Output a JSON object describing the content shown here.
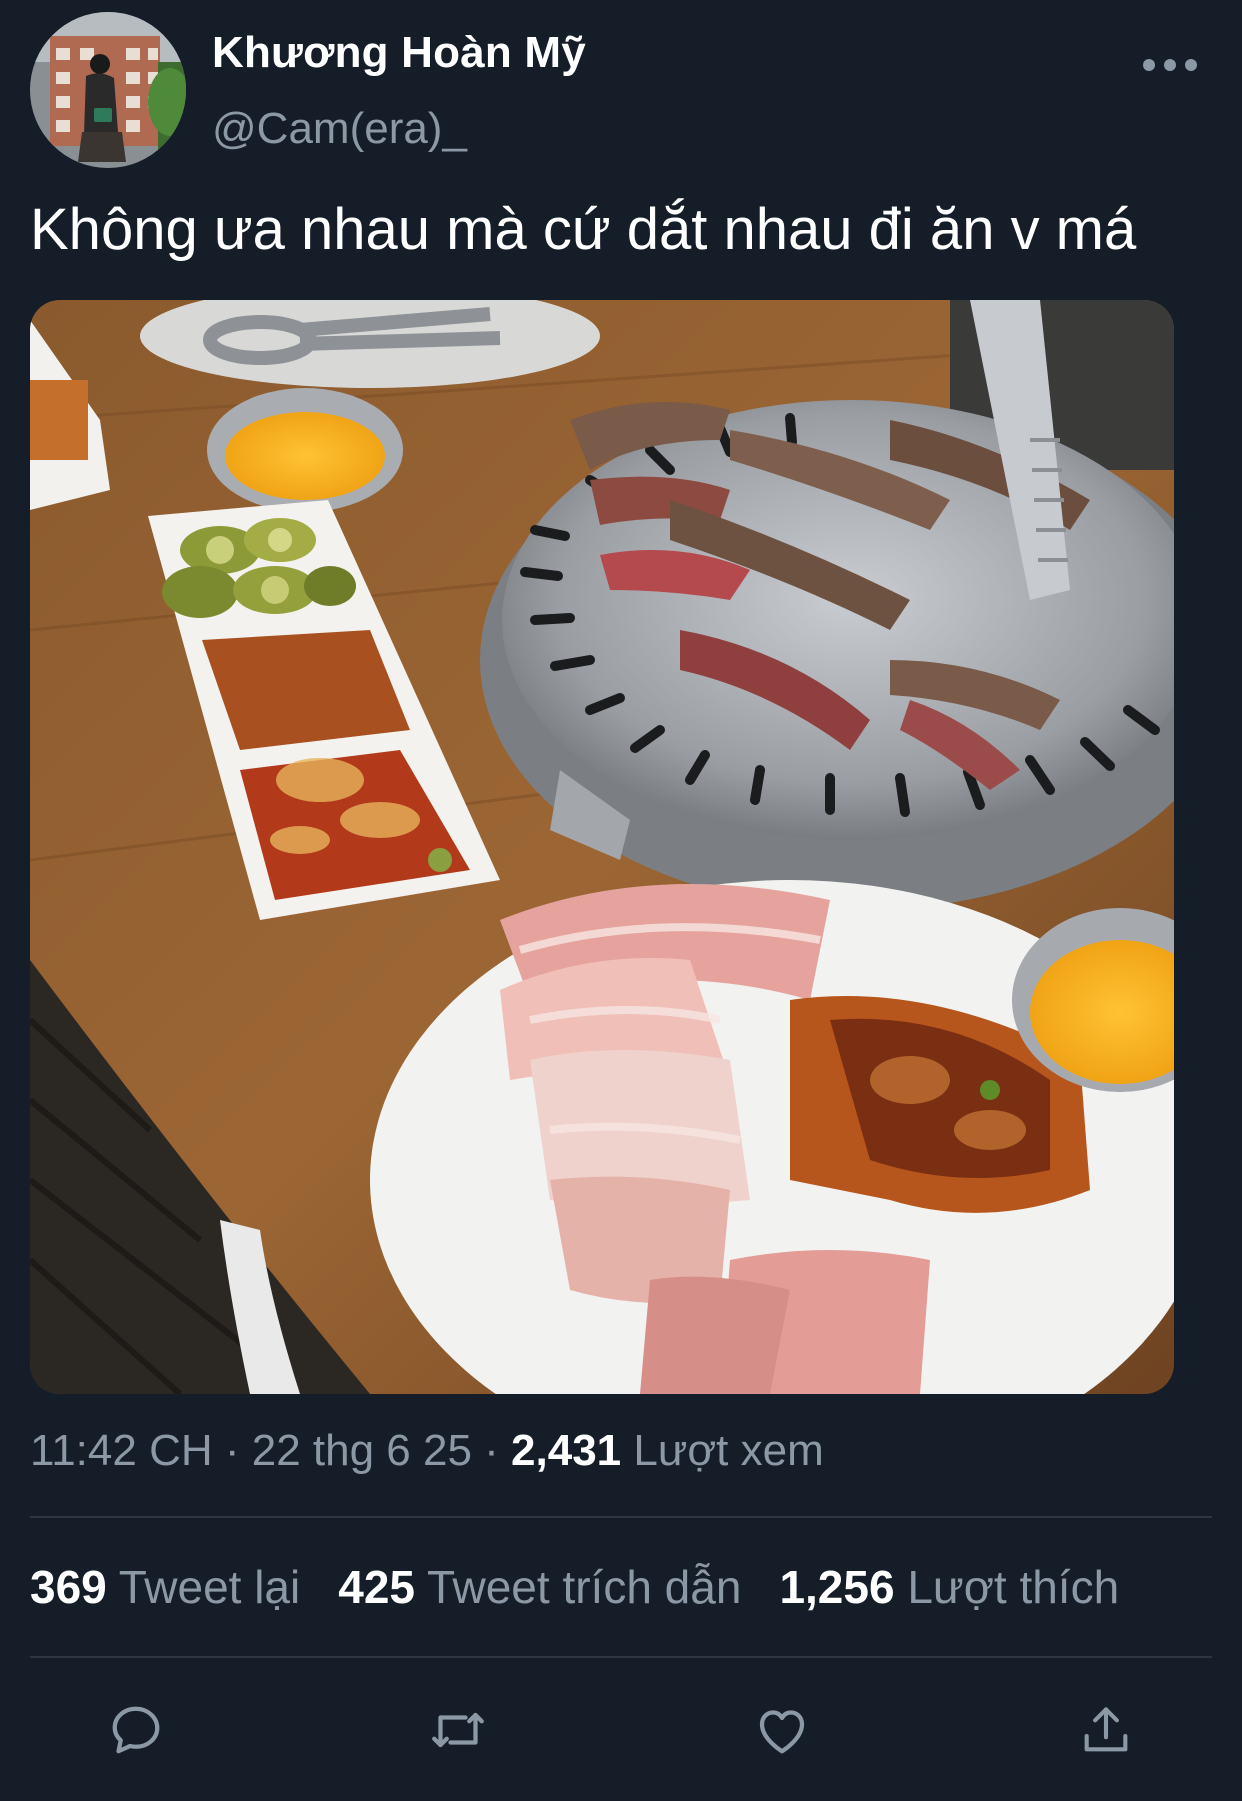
{
  "tweet": {
    "author": {
      "display_name": "Khương Hoàn Mỹ",
      "handle": "@Cam(era)_"
    },
    "text": "Không ưa nhau mà cứ dắt nhau đi ăn v má",
    "meta": {
      "time": "11:42 CH",
      "separator": " · ",
      "date": "22 thg 6 25",
      "views_count": "2,431",
      "views_label": "Lượt xem"
    },
    "stats": [
      {
        "count": "369",
        "label": "Tweet lại"
      },
      {
        "count": "425",
        "label": "Tweet trích dẫn"
      },
      {
        "count": "1,256",
        "label": "Lượt thích"
      }
    ],
    "actions": [
      {
        "icon": "reply-icon"
      },
      {
        "icon": "retweet-icon"
      },
      {
        "icon": "like-icon"
      },
      {
        "icon": "share-icon"
      }
    ]
  },
  "colors": {
    "background": "#151d29",
    "primary_text": "#ffffff",
    "secondary_text": "#8b98a5",
    "divider": "#2d3742"
  }
}
